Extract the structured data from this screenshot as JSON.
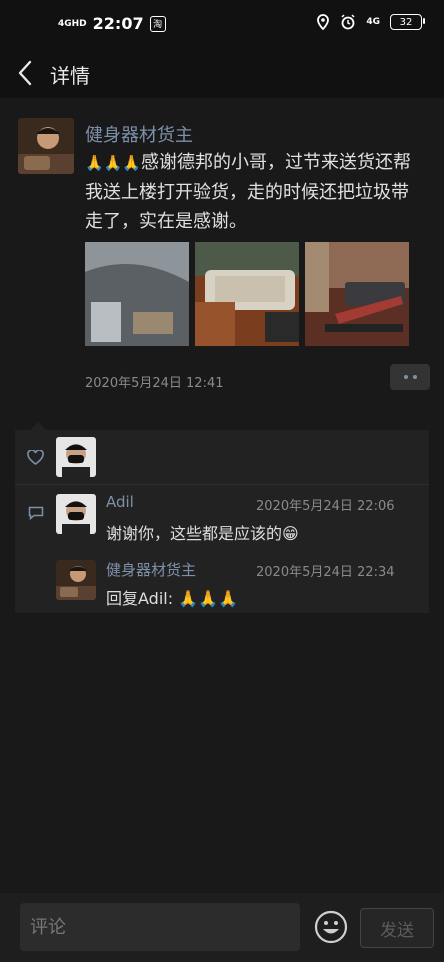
{
  "status_bar": {
    "network": "4GHD",
    "time": "22:07",
    "app_badge": "淘",
    "right_network": "4G",
    "battery": "32"
  },
  "nav": {
    "title": "详情"
  },
  "post": {
    "author": "健身器材货主",
    "emoji_prefix": "🙏🙏🙏",
    "text": "感谢德邦的小哥，过节来送货还帮我送上楼打开验货，走的时候还把垃圾带走了，实在是感谢。",
    "timestamp": "2020年5月24日 12:41",
    "photos": [
      "photo-1",
      "photo-2",
      "photo-3"
    ]
  },
  "comments": [
    {
      "name": "Adil",
      "time": "2020年5月24日 22:06",
      "text": "谢谢你，这些都是应该的😁"
    },
    {
      "name": "健身器材货主",
      "time": "2020年5月24日 22:34",
      "text": "回复Adil: 🙏🙏🙏"
    }
  ],
  "bottom_bar": {
    "placeholder": "评论",
    "send_label": "发送"
  },
  "colors": {
    "background": "#191919",
    "name_link": "#7d90a9",
    "panel": "#222222"
  }
}
